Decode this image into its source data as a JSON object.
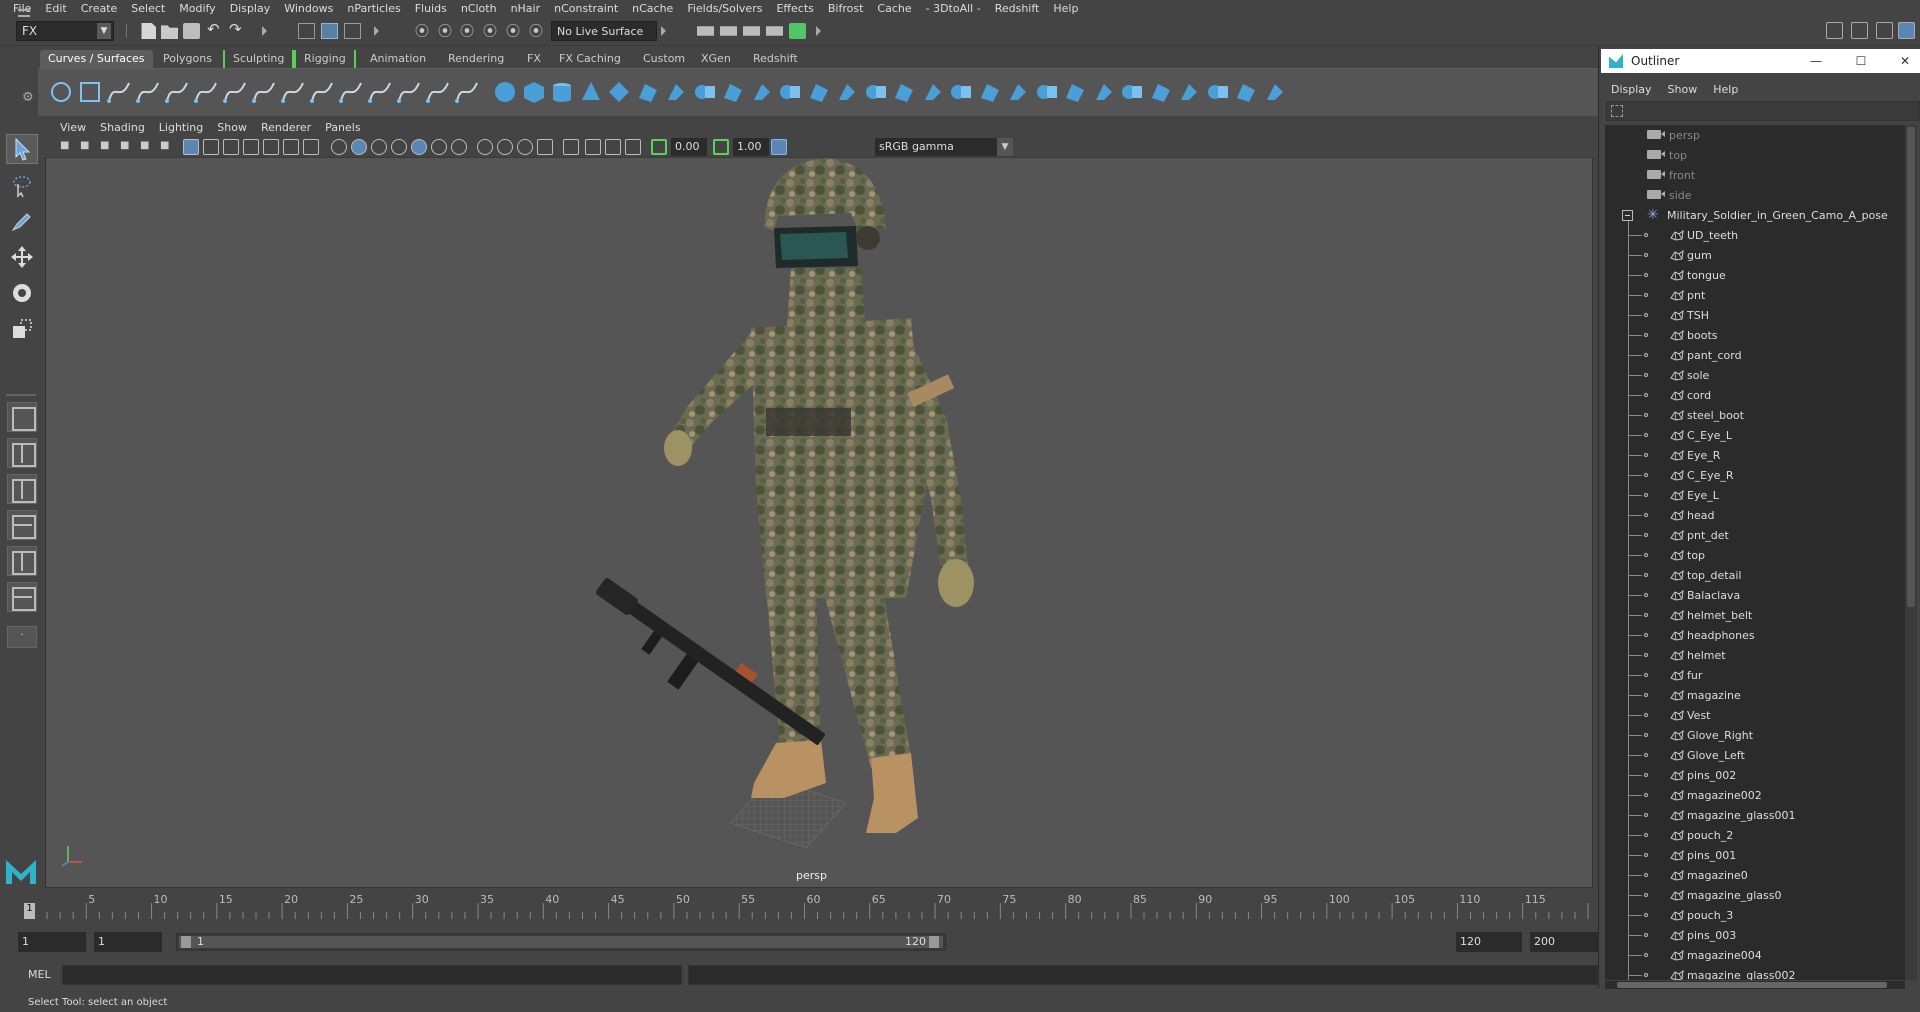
{
  "menubar": {
    "items": [
      "File",
      "Edit",
      "Create",
      "Select",
      "Modify",
      "Display",
      "Windows",
      "nParticles",
      "Fluids",
      "nCloth",
      "nHair",
      "nConstraint",
      "nCache",
      "Fields/Solvers",
      "Effects",
      "Bifrost",
      "Cache",
      "- 3DtoAll -",
      "Redshift",
      "Help"
    ]
  },
  "statusline": {
    "mode": "FX",
    "live_surface": "No Live Surface"
  },
  "shelf": {
    "tabs": [
      "Curves / Surfaces",
      "Polygons",
      "Sculpting",
      "Rigging",
      "Animation",
      "Rendering",
      "FX",
      "FX Caching",
      "Custom",
      "XGen",
      "Redshift"
    ],
    "active_tab": "Curves / Surfaces"
  },
  "viewport": {
    "menu": [
      "View",
      "Shading",
      "Lighting",
      "Show",
      "Renderer",
      "Panels"
    ],
    "exposure": "0.00",
    "gamma": "1.00",
    "color_space": "sRGB gamma",
    "camera_label": "persp"
  },
  "outliner": {
    "title": "Outliner",
    "menu": [
      "Display",
      "Show",
      "Help"
    ],
    "cameras": [
      "persp",
      "top",
      "front",
      "side"
    ],
    "group": "Military_Soldier_in_Green_Camo_A_pose",
    "children": [
      "UD_teeth",
      "gum",
      "tongue",
      "pnt",
      "TSH",
      "boots",
      "pant_cord",
      "sole",
      "cord",
      "steel_boot",
      "C_Eye_L",
      "Eye_R",
      "C_Eye_R",
      "Eye_L",
      "head",
      "pnt_det",
      "top",
      "top_detail",
      "Balaclava",
      "helmet_belt",
      "headphones",
      "helmet",
      "fur",
      "magazine",
      "Vest",
      "Glove_Right",
      "Glove_Left",
      "pins_002",
      "magazine002",
      "magazine_glass001",
      "pouch_2",
      "pins_001",
      "magazine0",
      "magazine_glass0",
      "pouch_3",
      "pins_003",
      "magazine004",
      "magazine_glass002"
    ]
  },
  "timeslider": {
    "ticks": [
      "5",
      "10",
      "15",
      "20",
      "25",
      "30",
      "35",
      "40",
      "45",
      "50",
      "55",
      "60",
      "65",
      "70",
      "75",
      "80",
      "85",
      "90",
      "95",
      "100",
      "105",
      "110",
      "115"
    ],
    "current_frame": "1"
  },
  "rangeslider": {
    "start_time": "1",
    "playback_start": "1",
    "range_start_label": "1",
    "range_end_label": "120",
    "playback_end": "120",
    "end_time": "200"
  },
  "cmdline": {
    "language": "MEL"
  },
  "helpline": {
    "text": "Select Tool: select an object"
  },
  "colors": {
    "active_blue": "#5b86b6",
    "surface_blue": "#4a9fd8",
    "bracket_green": "#58d058"
  }
}
